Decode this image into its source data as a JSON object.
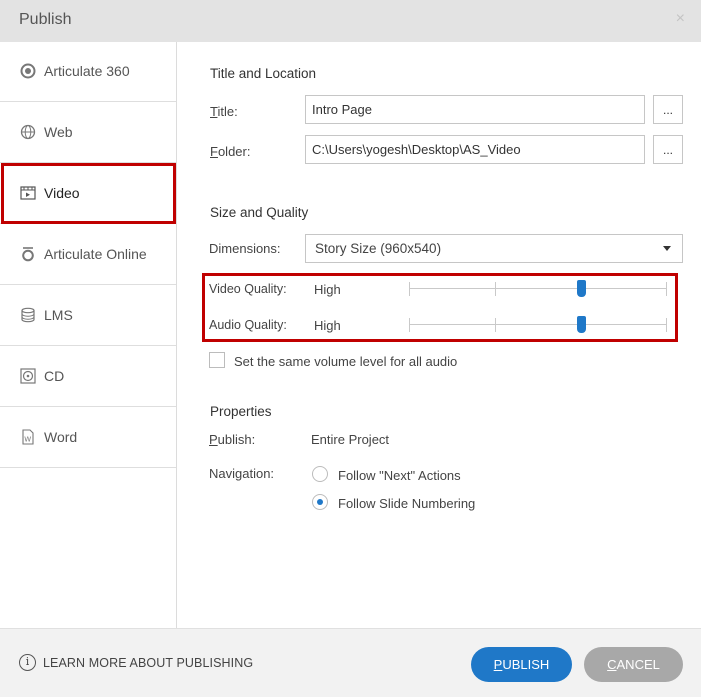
{
  "window": {
    "title": "Publish",
    "close_label": "×"
  },
  "sidebar": {
    "items": [
      {
        "label": "Articulate 360",
        "icon": "articulate-360-icon"
      },
      {
        "label": "Web",
        "icon": "globe-icon"
      },
      {
        "label": "Video",
        "icon": "video-film-icon"
      },
      {
        "label": "Articulate Online",
        "icon": "articulate-online-icon"
      },
      {
        "label": "LMS",
        "icon": "database-icon"
      },
      {
        "label": "CD",
        "icon": "disc-icon"
      },
      {
        "label": "Word",
        "icon": "word-document-icon"
      }
    ],
    "selected": "Video"
  },
  "title_location": {
    "heading": "Title and Location",
    "title_label_underlined": "T",
    "title_label_rest": "itle:",
    "title_value": "Intro Page",
    "folder_label_underlined": "F",
    "folder_label_rest": "older:",
    "folder_value": "C:\\Users\\yogesh\\Desktop\\AS_Video",
    "browse_label": "..."
  },
  "size_quality": {
    "heading": "Size and Quality",
    "dimensions_label": "Dimensions:",
    "dimensions_value": "Story Size (960x540)",
    "video_quality_label": "Video Quality:",
    "video_quality_value": "High",
    "video_quality_level": 0.67,
    "audio_quality_label": "Audio Quality:",
    "audio_quality_value": "High",
    "audio_quality_level": 0.67,
    "same_volume_label": "Set the same volume level for all audio",
    "same_volume_checked": false
  },
  "properties": {
    "heading": "Properties",
    "publish_label_underlined": "P",
    "publish_label_rest": "ublish:",
    "publish_value": "Entire Project",
    "navigation_label": "Navigation:",
    "nav_option_1": "Follow \"Next\" Actions",
    "nav_option_2": "Follow Slide Numbering",
    "nav_selected": 2
  },
  "footer": {
    "info_icon_glyph": "i",
    "learn_more": "LEARN MORE ABOUT PUBLISHING",
    "publish_button_underlined": "P",
    "publish_button_rest": "UBLISH",
    "cancel_button_underlined": "C",
    "cancel_button_rest": "ANCEL"
  },
  "colors": {
    "accent": "#1f78c8",
    "highlight": "#c00000",
    "cancel": "#a8a8a8"
  }
}
